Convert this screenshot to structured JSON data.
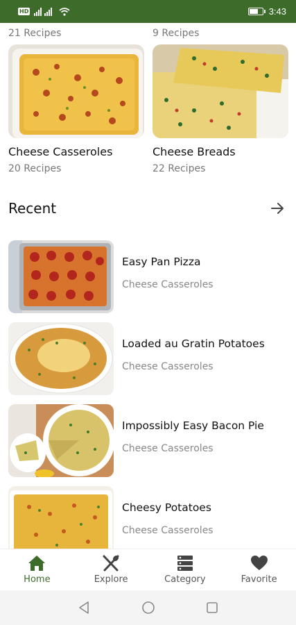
{
  "status_bar": {
    "hd": "HD",
    "time": "3:43",
    "battery_level": 0.7
  },
  "categories_top": {
    "left_count": "21 Recipes",
    "right_count": "9 Recipes"
  },
  "categories": [
    {
      "title": "Cheese Casseroles",
      "count": "20 Recipes"
    },
    {
      "title": "Cheese Breads",
      "count": "22 Recipes"
    }
  ],
  "recent": {
    "title": "Recent",
    "items": [
      {
        "title": "Easy Pan Pizza",
        "category": "Cheese Casseroles"
      },
      {
        "title": "Loaded au Gratin Potatoes",
        "category": "Cheese Casseroles"
      },
      {
        "title": "Impossibly Easy Bacon Pie",
        "category": "Cheese Casseroles"
      },
      {
        "title": "Cheesy Potatoes",
        "category": "Cheese Casseroles"
      }
    ]
  },
  "bottom_nav": [
    {
      "label": "Home",
      "icon": "home-icon",
      "active": true
    },
    {
      "label": "Explore",
      "icon": "fork-knife-icon",
      "active": false
    },
    {
      "label": "Category",
      "icon": "category-icon",
      "active": false
    },
    {
      "label": "Favorite",
      "icon": "heart-icon",
      "active": false
    }
  ],
  "colors": {
    "brand": "#3d6b2a",
    "muted_text": "#777777"
  }
}
